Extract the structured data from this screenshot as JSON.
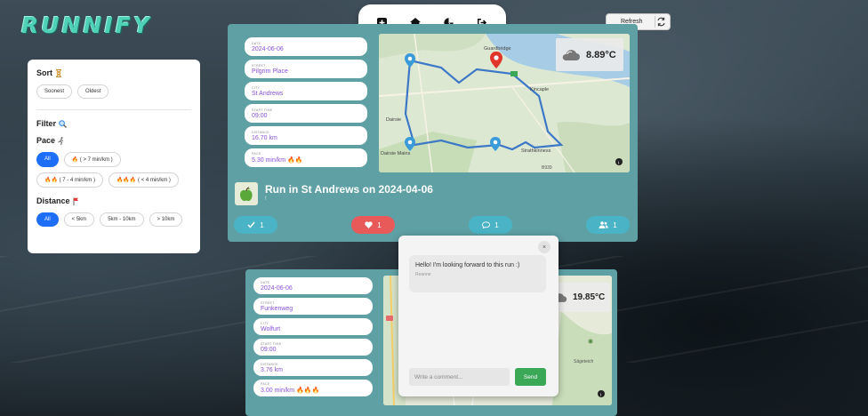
{
  "app": {
    "logo": "RUNNIFY"
  },
  "nav": {
    "icons": [
      "add-icon",
      "home-icon",
      "chart-icon",
      "logout-icon"
    ]
  },
  "refresh": {
    "label": "Refresh"
  },
  "sidebar": {
    "sort_title": "Sort",
    "sort_options": [
      "Soonest",
      "Oldest"
    ],
    "filter_title": "Filter",
    "pace_title": "Pace",
    "pace_options": [
      "All",
      "🔥 ( > 7 min/km )",
      "🔥🔥 ( 7 - 4 min/km )",
      "🔥🔥🔥 ( < 4 min/km )"
    ],
    "distance_title": "Distance",
    "distance_options": [
      "All",
      "< 5km",
      "5km - 10km",
      "> 10km"
    ]
  },
  "cards": [
    {
      "date_label": "DATE",
      "date": "2024-06-06",
      "street_label": "STREET",
      "street": "Pilgrim Place",
      "city_label": "CITY",
      "city": "St Andrews",
      "time_label": "START TIME",
      "time": "09:00",
      "distance_label": "DISTANCE",
      "distance": "16.70 km",
      "pace_label": "PACE",
      "pace": "5.30 min/km 🔥🔥",
      "weather": "8.89°C",
      "title": "Run in St Andrews on 2024-04-06",
      "subtitle": "!",
      "joined_count": "1",
      "likes_count": "1",
      "comments_count": "1",
      "participants_count": "1",
      "map_labels": [
        "Guardbridge",
        "Dairsie",
        "Strathkinness",
        "Kincaple",
        "Dairsie Mains",
        "B939"
      ]
    },
    {
      "date_label": "DATE",
      "date": "2024-06-06",
      "street_label": "STREET",
      "street": "Funkenweg",
      "city_label": "CITY",
      "city": "Wolfurt",
      "time_label": "START TIME",
      "time": "09:00",
      "distance_label": "DISTANCE",
      "distance": "3.76 km",
      "pace_label": "PACE",
      "pace": "3.00 min/km 🔥🔥🔥",
      "weather": "19.85°C",
      "map_labels": [
        "Sägeteich"
      ]
    }
  ],
  "comments": {
    "message": "Hello! I'm looking forward to this run :)",
    "author": "Reanne",
    "input_placeholder": "Write a comment...",
    "send_label": "Send",
    "close_label": "×"
  },
  "colors": {
    "accent": "#4fd1b8",
    "card": "#5fa0a4",
    "purple_value": "#8a52d8",
    "primary_blue": "#1e6ff5",
    "like_red": "#e85a5a",
    "send_green": "#3aa857"
  }
}
